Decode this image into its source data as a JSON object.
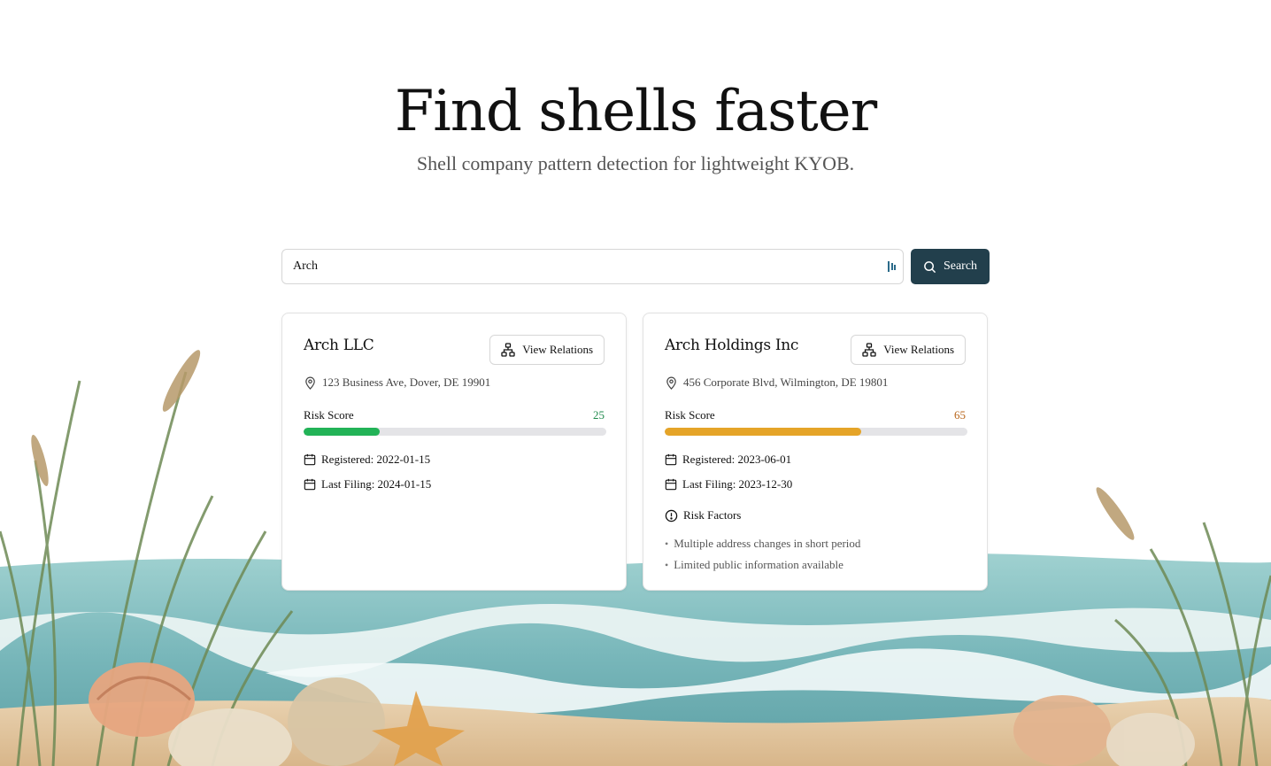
{
  "hero": {
    "title": "Find shells faster",
    "subtitle": "Shell company pattern detection for lightweight KYOB."
  },
  "search": {
    "value": "Arch",
    "button_label": "Search"
  },
  "results": [
    {
      "name": "Arch LLC",
      "relations_label": "View Relations",
      "address": "123 Business Ave, Dover, DE 19901",
      "risk_label": "Risk Score",
      "risk_score": "25",
      "risk_fraction": 0.25,
      "risk_color": "#22b357",
      "registered": "Registered: 2022-01-15",
      "last_filing": "Last Filing: 2024-01-15"
    },
    {
      "name": "Arch Holdings Inc",
      "relations_label": "View Relations",
      "address": "456 Corporate Blvd, Wilmington, DE 19801",
      "risk_label": "Risk Score",
      "risk_score": "65",
      "risk_fraction": 0.65,
      "risk_color": "#e5a428",
      "registered": "Registered: 2023-06-01",
      "last_filing": "Last Filing: 2023-12-30",
      "risk_factors_label": "Risk Factors",
      "risk_factors": [
        "Multiple address changes in short period",
        "Limited public information available"
      ]
    }
  ],
  "colors": {
    "primary": "#223f4c",
    "low_risk_text": "#1f8a4c",
    "medium_risk_text": "#b8651a"
  }
}
